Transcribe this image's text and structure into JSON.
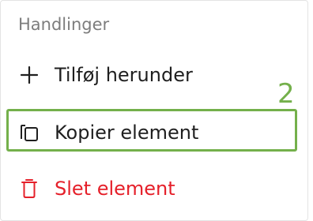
{
  "menu": {
    "section_title": "Handlinger",
    "items": [
      {
        "label": "Tilføj herunder",
        "icon": "plus-icon",
        "color": "#1f1f1f"
      },
      {
        "label": "Kopier element",
        "icon": "copy-icon",
        "color": "#1f1f1f"
      },
      {
        "label": "Slet element",
        "icon": "trash-icon",
        "color": "#e5202a"
      }
    ]
  },
  "annotation": {
    "number": "2",
    "color": "#74b04b"
  }
}
